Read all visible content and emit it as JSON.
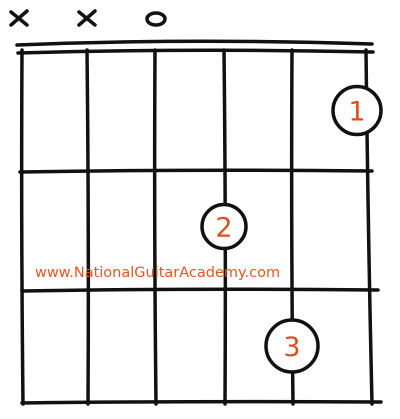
{
  "chord_diagram": {
    "string_markers": [
      {
        "string": 1,
        "marker": "x",
        "meaning": "muted"
      },
      {
        "string": 2,
        "marker": "x",
        "meaning": "muted"
      },
      {
        "string": 3,
        "marker": "o",
        "meaning": "open"
      },
      {
        "string": 4,
        "marker": ""
      },
      {
        "string": 5,
        "marker": ""
      },
      {
        "string": 6,
        "marker": ""
      }
    ],
    "strings": 6,
    "frets": 3,
    "fingers": [
      {
        "label": "1",
        "string": 6,
        "fret": 1
      },
      {
        "label": "2",
        "string": 4,
        "fret": 2
      },
      {
        "label": "3",
        "string": 5,
        "fret": 3
      }
    ],
    "colors": {
      "ink": "#111111",
      "finger_text": "#d9521c",
      "watermark": "#e5561f",
      "background": "#ffffff"
    }
  },
  "watermark": {
    "text": "www.NationalGuitarAcademy.com"
  }
}
